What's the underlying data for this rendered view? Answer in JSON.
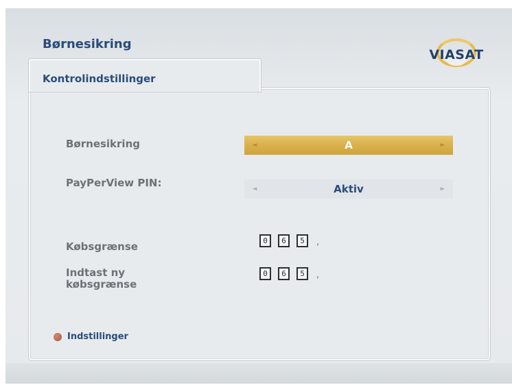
{
  "header": {
    "title": "Børnesikring",
    "logo_text": "VIASAT"
  },
  "tab": {
    "label": "Kontrolindstillinger"
  },
  "settings": {
    "parental_lock": {
      "label": "Børnesikring",
      "value": "A",
      "left_arrow": "◄",
      "right_arrow": "►"
    },
    "ppv_pin": {
      "label": "PayPerView PIN:",
      "value": "Aktiv",
      "left_arrow": "◄",
      "right_arrow": "►"
    },
    "purchase_limit": {
      "label": "Købsgrænse",
      "digits": [
        "0",
        "6",
        "5"
      ],
      "separator": ","
    },
    "new_purchase_limit": {
      "label_line1": "Indtast ny",
      "label_line2": "købsgrænse",
      "digits": [
        "0",
        "6",
        "5"
      ],
      "separator": ","
    }
  },
  "footer": {
    "hint_label": "Indstillinger",
    "hint_color": "#b05a44"
  },
  "colors": {
    "accent_gold": "#d9b04c",
    "title_blue": "#2a4c7a",
    "label_gray": "#6b7277"
  }
}
